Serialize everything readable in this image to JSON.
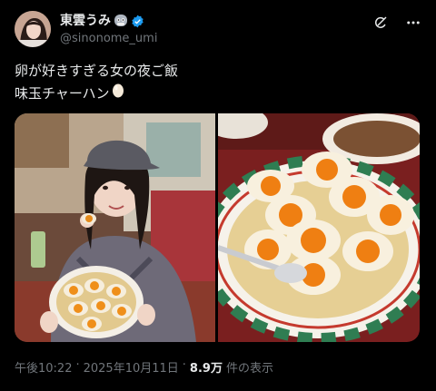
{
  "author": {
    "display_name": "東雲うみ",
    "handle": "@sinonome_umi"
  },
  "icons": {
    "verified": "verified-badge-icon",
    "name_emoji": "face-emoji-icon",
    "grok": "grok-icon",
    "more": "more-options-icon",
    "egg": "egg-emoji-icon"
  },
  "tweet": {
    "line1": "卵が好きすぎる女の夜ご飯",
    "line2": "味玉チャーハン"
  },
  "meta": {
    "time": "午後10:22",
    "sep1": "·",
    "date": "2025年10月11日",
    "sep2": "·",
    "views_count": "8.9万",
    "views_label": "件の表示"
  },
  "colors": {
    "background": "#000000",
    "text": "#e7e9ea",
    "muted": "#71767b",
    "verified_blue": "#1d9bf0"
  }
}
